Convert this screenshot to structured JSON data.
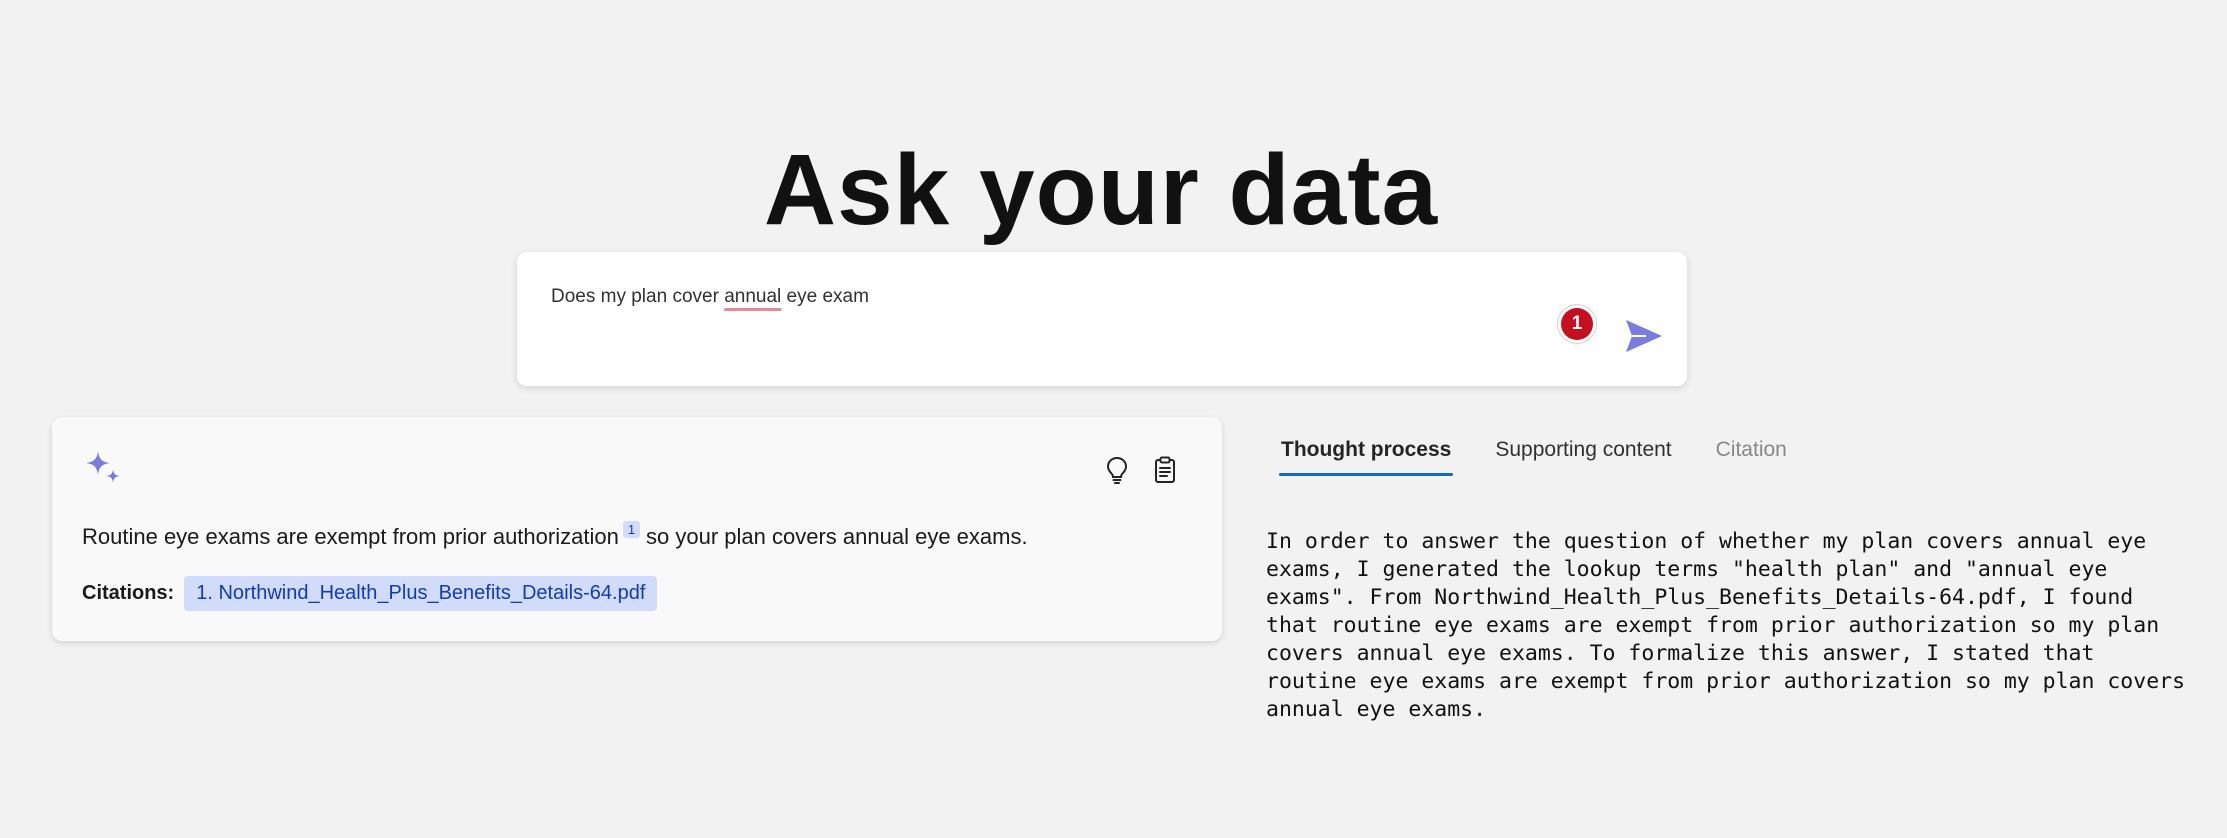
{
  "page": {
    "title": "Ask your data"
  },
  "question": {
    "before": "Does my plan cover ",
    "misspelled_word": "annual",
    "after": " eye exam",
    "badge_count": "1"
  },
  "answer": {
    "text_before": "Routine eye exams are exempt from prior authorization",
    "citation_marker": "1",
    "text_after": "so your plan covers annual eye exams.",
    "citations_label": "Citations:",
    "citation_link": "1. Northwind_Health_Plus_Benefits_Details-64.pdf"
  },
  "tabs": [
    {
      "label": "Thought process",
      "state": "active"
    },
    {
      "label": "Supporting content",
      "state": "normal"
    },
    {
      "label": "Citation",
      "state": "disabled"
    }
  ],
  "thought_process": "In order to answer the question of whether my plan covers annual eye exams, I generated the lookup terms \"health plan\" and \"annual eye exams\". From Northwind_Health_Plus_Benefits_Details-64.pdf, I found that routine eye exams are exempt from prior authorization so my plan covers annual eye exams. To formalize this answer, I stated that routine eye exams are exempt from prior authorization so my plan covers annual eye exams.",
  "icons": {
    "send": "send-icon",
    "sparkle": "sparkle-icon",
    "lightbulb": "lightbulb-icon",
    "clipboard": "clipboard-icon"
  },
  "colors": {
    "accent": "#7a7ce0",
    "badge": "#c50f1f",
    "citation_bg": "#d1dbfa",
    "citation_text": "#123bb6",
    "tab_underline": "#0f6cbd"
  }
}
